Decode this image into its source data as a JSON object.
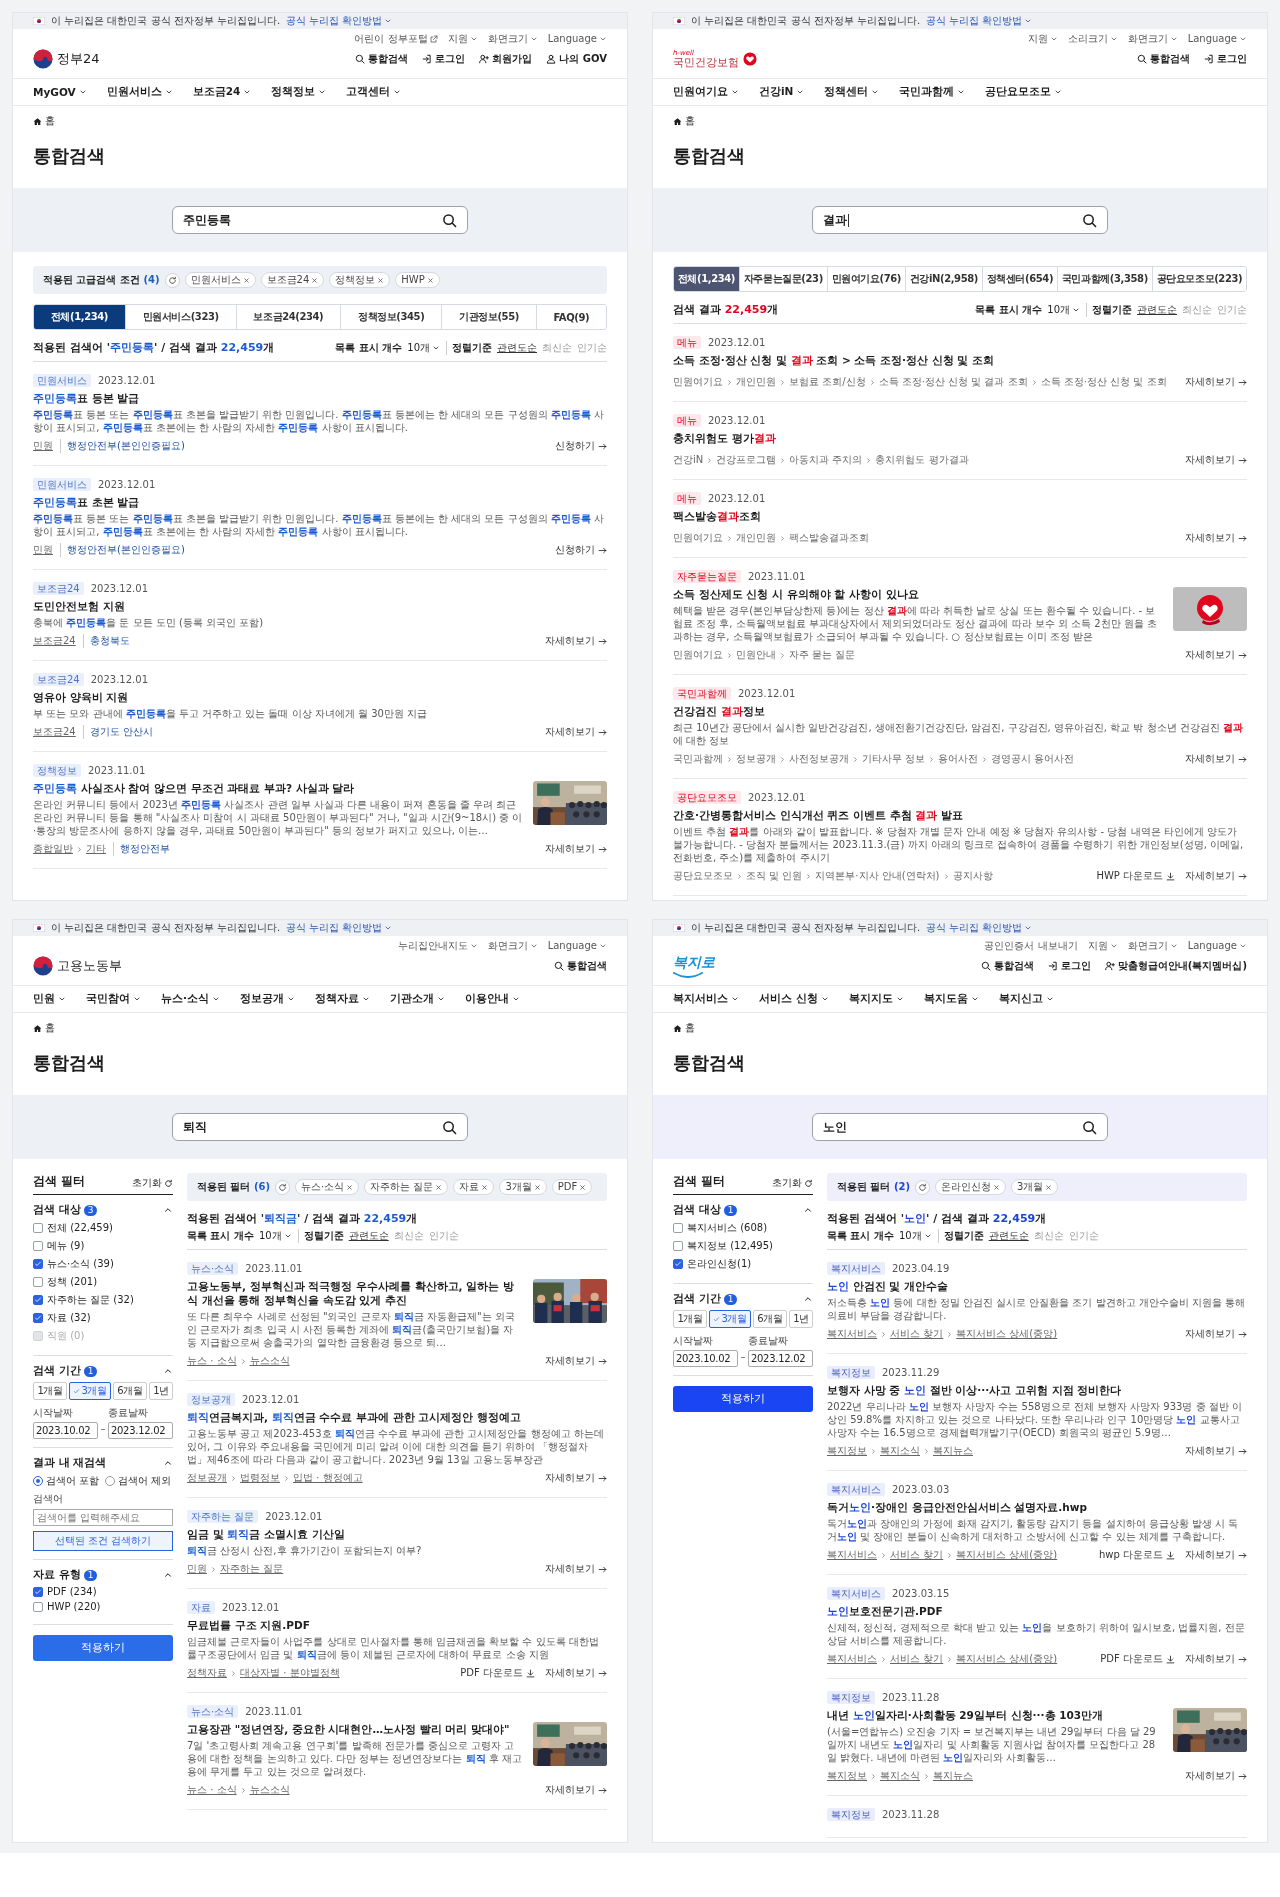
{
  "panels": [
    {
      "kind": "gov24",
      "banner": {
        "text": "이 누리집은 대한민국 공식 전자정부 누리집입니다.",
        "link": "공식 누리집 확인방법"
      },
      "util_links": [
        {
          "kind": "external",
          "label": "어린이 정부포털"
        },
        {
          "kind": "menu",
          "label": "지원"
        },
        {
          "kind": "menu",
          "label": "화면크기"
        },
        {
          "kind": "menu",
          "label": "Language"
        }
      ],
      "logo": {
        "kind": "taeguk",
        "text": "정부24"
      },
      "actions": [
        {
          "kind": "search",
          "label": "통합검색"
        },
        {
          "kind": "login",
          "label": "로그인"
        },
        {
          "kind": "join",
          "label": "회원가입"
        },
        {
          "kind": "user",
          "label": "나의 GOV"
        }
      ],
      "nav": [
        "MyGOV",
        "민원서비스",
        "보조금24",
        "정책정보",
        "고객센터"
      ],
      "breadcrumb": "홈",
      "title": "통합검색",
      "search": {
        "value": "주민등록",
        "cursor": false
      },
      "applied": {
        "label": "적용된 고급검색 조건 **(4)**",
        "chips": [
          "민원서비스",
          "보조금24",
          "정책정보",
          "HWP"
        ]
      },
      "tabs": [
        {
          "label": "전체(1,234)",
          "selected": true
        },
        {
          "label": "민원서비스(323)",
          "selected": false
        },
        {
          "label": "보조금24(234)",
          "selected": false
        },
        {
          "label": "정책정보(345)",
          "selected": false
        },
        {
          "label": "기관정보(55)",
          "selected": false
        },
        {
          "label": "FAQ(9)",
          "selected": false
        }
      ],
      "summary": {
        "text": "적용된 검색어 '**주민등록**' / 검색 결과 **22,459**개",
        "count_label": "목록 표시 개수",
        "count_value": "10개",
        "sort_label": "정렬기준",
        "sort": [
          {
            "label": "관련도순",
            "selected": true
          },
          {
            "label": "최신순",
            "selected": false
          },
          {
            "label": "인기순",
            "selected": false
          }
        ]
      },
      "results": [
        {
          "tag": "민원서비스",
          "date": "2023.12.01",
          "title": "**주민등록**표 등본 발급",
          "desc": "**주민등록**표 등본 또는 **주민등록**표 초본을 발급받기 위한 민원입니다. **주민등록**표 등본에는 한 세대의 모든 구성원의 **주민등록** 사항이 표시되고, **주민등록**표 초본에는 한 사람의 자세한 **주민등록** 사항이 표시됩니다.",
          "path": [
            "민원"
          ],
          "org": "행정안전부(본인인증필요)",
          "action": "신청하기"
        },
        {
          "tag": "민원서비스",
          "date": "2023.12.01",
          "title": "**주민등록**표 초본 발급",
          "desc": "**주민등록**표 등본 또는 **주민등록**표 초본을 발급받기 위한 민원입니다. **주민등록**표 등본에는 한 세대의 모든 구성원의 **주민등록** 사항이 표시되고, **주민등록**표 초본에는 한 사람의 자세한 **주민등록** 사항이 표시됩니다.",
          "path": [
            "민원"
          ],
          "org": "행정안전부(본인인증필요)",
          "action": "신청하기"
        },
        {
          "tag": "보조금24",
          "date": "2023.12.01",
          "title": "도민안전보험 지원",
          "desc": "충북에 **주민등록**을 둔 모든 도민 (등록 외국인 포함)",
          "path": [
            "보조금24"
          ],
          "org": "충청북도",
          "action": "자세히보기"
        },
        {
          "tag": "보조금24",
          "date": "2023.12.01",
          "title": "영유아 양육비 지원",
          "desc": "부 또는 모와 관내에 **주민등록**을 두고 거주하고 있는 돌때 이상 자녀에게 월 30만원 지급",
          "path": [
            "보조금24"
          ],
          "org": "경기도 안산시",
          "action": "자세히보기"
        },
        {
          "tag": "정책정보",
          "date": "2023.11.01",
          "title": "**주민등록** 사실조사 참여 않으면 무조건 과태료 부과? 사실과 달라",
          "desc": "온라인 커뮤니티 등에서 2023년 **주민등록** 사실조사 관련 일부 사실과 다른 내용이 퍼져 혼동을 줄 우려 최근 온라인 커뮤니티 등을 통해 \"사실조사 미참여 시 과태료 50만원이 부과된다\" 거나, \"일과 시간(9~18시) 중 이·통장의 방문조사에 응하지 않을 경우, 과태료 50만원이 부과된다\" 등의 정보가 퍼지고 있으나, 이는…",
          "thumbnail": {
            "kind": "picture"
          },
          "path": [
            "종합일반",
            "기타"
          ],
          "org": "행정안전부",
          "action": "자세히보기"
        }
      ]
    },
    {
      "kind": "nhis",
      "banner": {
        "text": "이 누리집은 대한민국 공식 전자정부 누리집입니다.",
        "link": "공식 누리집 확인방법"
      },
      "util_links": [
        {
          "kind": "menu",
          "label": "지원"
        },
        {
          "kind": "menu",
          "label": "소리크기"
        },
        {
          "kind": "menu",
          "label": "화면크기"
        },
        {
          "kind": "menu",
          "label": "Language"
        }
      ],
      "logo": {
        "kind": "nhis",
        "tagline": "h-well",
        "text": "국민건강보험"
      },
      "actions": [
        {
          "kind": "search",
          "label": "통합검색"
        },
        {
          "kind": "login",
          "label": "로그인"
        }
      ],
      "nav": [
        "민원여기요",
        "건강iN",
        "정책센터",
        "국민과함께",
        "공단요모조모"
      ],
      "breadcrumb": "홈",
      "title": "통합검색",
      "search": {
        "value": "결과",
        "cursor": true
      },
      "tabs": [
        {
          "label": "전체(1,234)",
          "selected": true
        },
        {
          "label": "자주묻는질문(23)",
          "selected": false
        },
        {
          "label": "민원여기요(76)",
          "selected": false
        },
        {
          "label": "건강iN(2,958)",
          "selected": false
        },
        {
          "label": "정책센터(654)",
          "selected": false
        },
        {
          "label": "국민과함께(3,358)",
          "selected": false
        },
        {
          "label": "공단요모조모(223)",
          "selected": false
        }
      ],
      "summary": {
        "text": "검색 결과 **22,459**개",
        "count_label": "목록 표시 개수",
        "count_value": "10개",
        "sort_label": "정렬기준",
        "sort": [
          {
            "label": "관련도순",
            "selected": true
          },
          {
            "label": "최신순",
            "selected": false
          },
          {
            "label": "인기순",
            "selected": false
          }
        ]
      },
      "results": [
        {
          "tag": "메뉴",
          "date": "2023.12.01",
          "title": "소득 조정·정산 신청 및 **결과** 조회 > 소득 조정·정산 신청 및 조회",
          "path": [
            "민원여기요",
            "개인민원",
            "보험료 조회/신청",
            "소득 조정·정산 신청 및 결과 조회",
            "소득 조정·정산 신청 및 조회"
          ],
          "action": "자세히보기"
        },
        {
          "tag": "메뉴",
          "date": "2023.12.01",
          "title": "충치위험도 평가**결과**",
          "path": [
            "건강iN",
            "건강프로그램",
            "아동치과 주치의",
            "충치위험도 평가결과"
          ],
          "action": "자세히보기"
        },
        {
          "tag": "메뉴",
          "date": "2023.12.01",
          "title": "팩스발송**결과**조회",
          "path": [
            "민원여기요",
            "개인민원",
            "팩스발송결과조회"
          ],
          "action": "자세히보기"
        },
        {
          "tag": "자주묻는질문",
          "date": "2023.11.01",
          "title": "소득 정산제도 신청 시 유의해야 할 사항이 있나요",
          "desc": "혜택을 받은 경우(본인부담상한제 등)에는 정산 **결과**에 따라 취득한 날로 상실 또는 환수될 수 있습니다. - 보험료 조정 후, 소득월액보험료 부과대상자에서 제외되었더라도 정산 결과에 따라 보수 외 소득 2천만 원을 초과하는 경우, 소득월액보험료가 소급되어 부과될 수 있습니다. ○ 정산보험료는 이미 조정 받은",
          "thumbnail": {
            "kind": "logo"
          },
          "path": [
            "민원여기요",
            "민원안내",
            "자주 묻는 질문"
          ],
          "action": "자세히보기"
        },
        {
          "tag": "국민과함께",
          "date": "2023.12.01",
          "title": "건강검진 **결과**정보",
          "desc": "최근 10년간 공단에서 실시한 일반건강검진, 생애전환기건강진단, 암검진, 구강검진, 영유아검진, 학교 밖 청소년 건강검진 **결과**에 대한 정보",
          "path": [
            "국민과함께",
            "정보공개",
            "사전정보공개",
            "기타사무 정보",
            "용어사전",
            "경영공시 용어사전"
          ],
          "action": "자세히보기"
        },
        {
          "tag": "공단요모조모",
          "date": "2023.12.01",
          "title": "간호·간병통합서비스 인식개선 퀴즈 이벤트 추첨 **결과** 발표",
          "desc": "이벤트 추첨 **결과**를 아래와 같이 발표합니다. ※ 당첨자 개별 문자 안내 예정 ※ 당첨자 유의사항 - 당첨 내역은 타인에게 양도가 불가능합니다. - 당첨자 분들께서는 2023.11.3.(금) 까지 아래의 링크로 접속하여 경품을 수령하기 위한 개인정보(성명, 이메일, 전화번호, 주소)를 제출하여 주시기",
          "path": [
            "공단요모조모",
            "조직 및 인원",
            "지역본부·지사 안내(연락처)",
            "공지사항"
          ],
          "download": "HWP 다운로드",
          "action": "자세히보기"
        }
      ]
    },
    {
      "kind": "moel",
      "banner": {
        "text": "이 누리집은 대한민국 공식 전자정부 누리집입니다.",
        "link": "공식 누리집 확인방법"
      },
      "util_links": [
        {
          "kind": "menu",
          "label": "누리집안내지도"
        },
        {
          "kind": "menu",
          "label": "화면크기"
        },
        {
          "kind": "menu",
          "label": "Language"
        }
      ],
      "logo": {
        "kind": "taeguk",
        "text": "고용노동부"
      },
      "actions": [
        {
          "kind": "search",
          "label": "통합검색"
        }
      ],
      "nav": [
        "민원",
        "국민참여",
        "뉴스·소식",
        "정보공개",
        "정책자료",
        "기관소개",
        "이용안내"
      ],
      "breadcrumb": "홈",
      "title": "통합검색",
      "search": {
        "value": "퇴직",
        "cursor": false
      },
      "filter": {
        "title": "검색 필터",
        "reset": "초기화",
        "apply": "적용하기",
        "groups": [
          {
            "kind": "checks",
            "title": "검색 대상",
            "badge": "3",
            "expanded": true,
            "options": [
              {
                "label": "전체 (22,459)",
                "checked": false,
                "disabled": false
              },
              {
                "label": "메뉴 (9)",
                "checked": false,
                "disabled": false
              },
              {
                "label": "뉴스·소식 (39)",
                "checked": true,
                "disabled": false
              },
              {
                "label": "정책 (201)",
                "checked": false,
                "disabled": false
              },
              {
                "label": "자주하는 질문 (32)",
                "checked": true,
                "disabled": false
              },
              {
                "label": "자료 (32)",
                "checked": true,
                "disabled": false
              },
              {
                "label": "직원 (0)",
                "checked": false,
                "disabled": true
              }
            ]
          },
          {
            "kind": "period",
            "title": "검색 기간",
            "badge": "1",
            "expanded": true,
            "periods": [
              {
                "label": "1개월",
                "selected": false
              },
              {
                "label": "3개월",
                "selected": true
              },
              {
                "label": "6개월",
                "selected": false
              },
              {
                "label": "1년",
                "selected": false
              }
            ],
            "start_label": "시작날짜",
            "start": "2023.10.02",
            "end_label": "종료날짜",
            "end": "2023.12.02"
          },
          {
            "kind": "research",
            "title": "결과 내 재검색",
            "expanded": true,
            "radios": [
              {
                "label": "검색어 포함",
                "selected": true
              },
              {
                "label": "검색어 제외",
                "selected": false
              }
            ],
            "field_label": "검색어",
            "placeholder": "검색어를 입력해주세요",
            "button": "선택된 조건 검색하기"
          },
          {
            "kind": "checks",
            "title": "자료 유형",
            "badge": "1",
            "expanded": true,
            "options": [
              {
                "label": "PDF (234)",
                "checked": true,
                "disabled": false
              },
              {
                "label": "HWP (220)",
                "checked": false,
                "disabled": false
              }
            ]
          }
        ]
      },
      "applied": {
        "label": "적용된 필터 **(6)**",
        "chips": [
          "뉴스·소식",
          "자주하는 질문",
          "자료",
          "3개월",
          "PDF"
        ]
      },
      "summary": {
        "text": "적용된 검색어 '**퇴직금**' / 검색 결과 **22,459**개",
        "count_label": "목록 표시 개수",
        "count_value": "10개",
        "sort_label": "정렬기준",
        "sort": [
          {
            "label": "관련도순",
            "selected": true
          },
          {
            "label": "최신순",
            "selected": false
          },
          {
            "label": "인기순",
            "selected": false
          }
        ]
      },
      "results": [
        {
          "tag": "뉴스·소식",
          "date": "2023.11.01",
          "title": "고용노동부, 정부혁신과 적극행정 우수사례를 확산하고, 일하는 방식 개선을 통해 정부혁신을 속도감 있게 추진",
          "desc": "또 다른 최우수 사례로 선정된 \"외국인 근로자 **퇴직**금 자동환급제\"는 외국인 근로자가 최초 입국 시 사전 등록한 계좌에 **퇴직**금(출국만기보험)을 자동 지급함으로써 송출국가의 열악한 금융환경 등으로 퇴…",
          "thumbnail": {
            "kind": "picture"
          },
          "path": [
            "뉴스 · 소식",
            "뉴스소식"
          ],
          "action": "자세히보기"
        },
        {
          "tag": "정보공개",
          "date": "2023.12.01",
          "title": "**퇴직**연금복지과, **퇴직**연금 수수료 부과에 관한 고시제정안 행정예고",
          "desc": "고용노동부 공고 제2023-453호 **퇴직**연금 수수료 부과에 관한 고시제정안을 행정예고 하는데 있어, 그 이유와 주요내용을 국민에게 미리 알려 이에 대한 의견을 듣기 위하여 「행정절차법」제46조에 따라 다음과 같이 공고합니다. 2023년 9월 13일 고용노동부장관",
          "path": [
            "정보공개",
            "법령정보",
            "입법 · 행정예고"
          ],
          "action": "자세히보기"
        },
        {
          "tag": "자주하는 질문",
          "date": "2023.12.01",
          "title": "임금 및 **퇴직**금 소멸시효 기산일",
          "desc": "**퇴직**금 산정시 산전,후 휴가기간이 포함되는지 여부?",
          "path": [
            "민원",
            "자주하는 질문"
          ],
          "action": "자세히보기"
        },
        {
          "tag": "자료",
          "date": "2023.12.01",
          "title": "무료법률 구조 지원.PDF",
          "desc": "임금체불 근로자들이 사업주를 상대로 민사절차를 통해 임금채권을 확보할 수 있도록 대한법률구조공단에서 임금 및 **퇴직**금에 등이 체불된 근로자에 대하여 무료로 소송 지원",
          "path": [
            "정책자료",
            "대상자별 · 분야별정책"
          ],
          "download": "PDF 다운로드",
          "action": "자세히보기"
        },
        {
          "tag": "뉴스·소식",
          "date": "2023.11.01",
          "title": "고용장관 \"정년연장, 중요한 시대현안…노사정 빨리 머리 맞대야\"",
          "desc": "7일 '초고령사회 계속고용 연구회'를 발족해 전문가를 중심으로 고령자 고용에 대한 정책을 논의하고 있다. 다만 정부는 정년연장보다는 **퇴직** 후 재고용에 무게를 두고 있는 것으로 알려졌다.",
          "thumbnail": {
            "kind": "picture"
          },
          "path": [
            "뉴스 · 소식",
            "뉴스소식"
          ],
          "action": "자세히보기"
        }
      ]
    },
    {
      "kind": "bokjiro",
      "banner": {
        "text": "이 누리집은 대한민국 공식 전자정부 누리집입니다.",
        "link": "공식 누리집 확인방법"
      },
      "util_links": [
        {
          "kind": "plain",
          "label": "공인인증서 내보내기"
        },
        {
          "kind": "menu",
          "label": "지원"
        },
        {
          "kind": "menu",
          "label": "화면크기"
        },
        {
          "kind": "menu",
          "label": "Language"
        }
      ],
      "logo": {
        "kind": "bokjiro",
        "text": "복지로"
      },
      "actions": [
        {
          "kind": "search",
          "label": "통합검색"
        },
        {
          "kind": "login",
          "label": "로그인"
        },
        {
          "kind": "join",
          "label": "맞춤형급여안내(복지멤버십)"
        }
      ],
      "nav": [
        "복지서비스",
        "서비스 신청",
        "복지지도",
        "복지도움",
        "복지신고"
      ],
      "breadcrumb": "홈",
      "title": "통합검색",
      "search": {
        "value": "노인",
        "cursor": false
      },
      "filter": {
        "title": "검색 필터",
        "reset": "초기화",
        "apply": "적용하기",
        "groups": [
          {
            "kind": "checks",
            "title": "검색 대상",
            "badge": "1",
            "expanded": true,
            "options": [
              {
                "label": "복지서비스 (608)",
                "checked": false,
                "disabled": false
              },
              {
                "label": "복지정보 (12,495)",
                "checked": false,
                "disabled": false
              },
              {
                "label": "온라인신청(1)",
                "checked": true,
                "disabled": false
              }
            ]
          },
          {
            "kind": "period",
            "title": "검색 기간",
            "badge": "1",
            "expanded": true,
            "periods": [
              {
                "label": "1개월",
                "selected": false
              },
              {
                "label": "3개월",
                "selected": true
              },
              {
                "label": "6개월",
                "selected": false
              },
              {
                "label": "1년",
                "selected": false
              }
            ],
            "start_label": "시작날짜",
            "start": "2023.10.02",
            "end_label": "종료날짜",
            "end": "2023.12.02"
          }
        ]
      },
      "applied": {
        "label": "적용된 필터 **(2)**",
        "chips": [
          "온라인신청",
          "3개월"
        ]
      },
      "summary": {
        "text": "적용된 검색어 '**노인**' / 검색 결과 **22,459**개",
        "count_label": "목록 표시 개수",
        "count_value": "10개",
        "sort_label": "정렬기준",
        "sort": [
          {
            "label": "관련도순",
            "selected": true
          },
          {
            "label": "최신순",
            "selected": false
          },
          {
            "label": "인기순",
            "selected": false
          }
        ]
      },
      "results": [
        {
          "tag": "복지서비스",
          "date": "2023.04.19",
          "title": "**노인** 안검진 및 개안수술",
          "desc": "저소득층 **노인** 등에 대한 정밀 안검진 실시로 안질환을 조기 발견하고 개안수술비 지원을 통해 의료비 부담을 경감합니다.",
          "path": [
            "복지서비스",
            "서비스 찾기",
            "복지서비스 상세(중앙)"
          ],
          "action": "자세히보기"
        },
        {
          "tag": "복지정보",
          "date": "2023.11.29",
          "title": "보행자 사망 중 **노인** 절반 이상···사고 고위험 지점 정비한다",
          "desc": "2022년 우리나라 **노인** 보행자 사망자 수는 558명으로 전체 보행자 사망자 933명 중 절반 이상인 59.8%를 차지하고 있는 것으로 나타났다. 또한 우리나라 인구 10만명당 **노인** 교통사고 사망자 수는 16.5명으로 경제협력개발기구(OECD) 회원국의 평균인 5.9명…",
          "path": [
            "복지정보",
            "복지소식",
            "복지뉴스"
          ],
          "action": "자세히보기"
        },
        {
          "tag": "복지서비스",
          "date": "2023.03.03",
          "title": "독거**노인**·장애인 응급안전안심서비스 설명자료.hwp",
          "desc": "독거**노인**과 장애인의 가정에 화재 감지기, 활동량 감지기 등을 설치하여 응급상황 발생 시 독거**노인** 및 장애인 분들이 신속하게 대처하고 소방서에 신고할 수 있는 체계를 구축합니다.",
          "path": [
            "복지서비스",
            "서비스 찾기",
            "복지서비스 상세(중앙)"
          ],
          "download": "hwp 다운로드",
          "action": "자세히보기"
        },
        {
          "tag": "복지서비스",
          "date": "2023.03.15",
          "title": "**노인**보호전문기관.PDF",
          "desc": "신체적, 정신적, 경제적으로 학대 받고 있는 **노인**을 보호하기 위하여 일시보호, 법률지원, 전문상담 서비스를 제공합니다.",
          "path": [
            "복지서비스",
            "서비스 찾기",
            "복지서비스 상세(중앙)"
          ],
          "download": "PDF 다운로드",
          "action": "자세히보기"
        },
        {
          "tag": "복지정보",
          "date": "2023.11.28",
          "title": "내년 **노인**일자리·사회활동 29일부터 신청···총 103만개",
          "desc": "(서울=연합뉴스) 오진송 기자 = 보건복지부는 내년 29일부터 다음 달 29일까지 내년도 **노인**일자리 및 사회활동 지원사업 참여자를 모집한다고 28일 밝혔다. 내년에 마련된 **노인**일자리와 사회활동…",
          "thumbnail": {
            "kind": "picture"
          },
          "path": [
            "복지정보",
            "복지소식",
            "복지뉴스"
          ],
          "action": "자세히보기"
        },
        {
          "tag": "복지정보",
          "date": "2023.11.28"
        }
      ]
    }
  ]
}
